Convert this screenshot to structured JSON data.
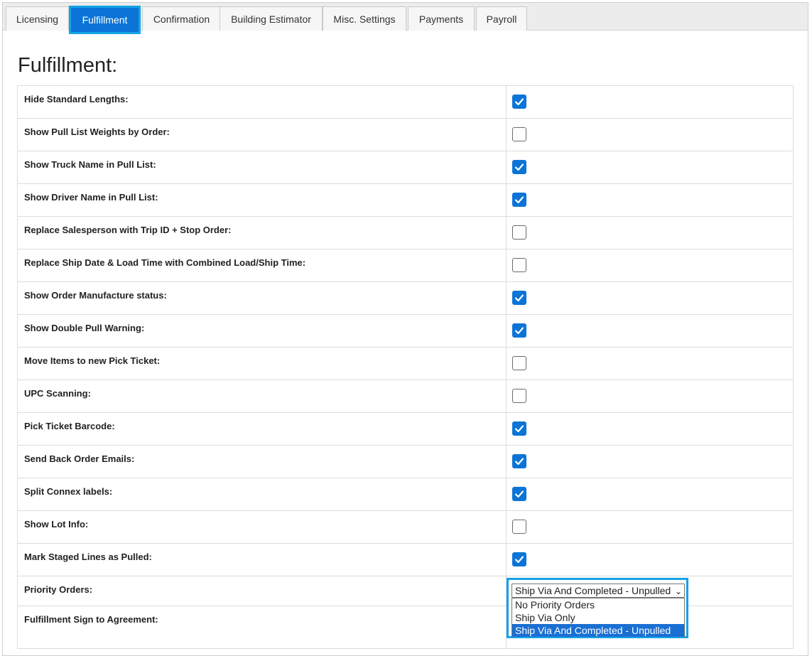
{
  "tabs": [
    {
      "label": "Licensing",
      "active": false
    },
    {
      "label": "Fulfillment",
      "active": true
    },
    {
      "label": "Confirmation",
      "active": false
    },
    {
      "label": "Building Estimator",
      "active": false
    },
    {
      "label": "Misc. Settings",
      "active": false
    },
    {
      "label": "Payments",
      "active": false
    },
    {
      "label": "Payroll",
      "active": false
    }
  ],
  "page_title": "Fulfillment:",
  "settings": [
    {
      "label": "Hide Standard Lengths:",
      "checked": true
    },
    {
      "label": "Show Pull List Weights by Order:",
      "checked": false
    },
    {
      "label": "Show Truck Name in Pull List:",
      "checked": true
    },
    {
      "label": "Show Driver Name in Pull List:",
      "checked": true
    },
    {
      "label": "Replace Salesperson with Trip ID + Stop Order:",
      "checked": false
    },
    {
      "label": "Replace Ship Date & Load Time with Combined Load/Ship Time:",
      "checked": false
    },
    {
      "label": "Show Order Manufacture status:",
      "checked": true
    },
    {
      "label": "Show Double Pull Warning:",
      "checked": true
    },
    {
      "label": "Move Items to new Pick Ticket:",
      "checked": false
    },
    {
      "label": "UPC Scanning:",
      "checked": false
    },
    {
      "label": "Pick Ticket Barcode:",
      "checked": true
    },
    {
      "label": "Send Back Order Emails:",
      "checked": true
    },
    {
      "label": "Split Connex labels:",
      "checked": true
    },
    {
      "label": "Show Lot Info:",
      "checked": false
    },
    {
      "label": "Mark Staged Lines as Pulled:",
      "checked": true
    }
  ],
  "priority_orders": {
    "label": "Priority Orders:",
    "selected": "Ship Via And Completed - Unpulled",
    "options": [
      "No Priority Orders",
      "Ship Via Only",
      "Ship Via And Completed - Unpulled"
    ]
  },
  "sign_agreement": {
    "label": "Fulfillment Sign to Agreement:"
  },
  "colors": {
    "accent": "#0b74d6",
    "highlight_border": "#14a3e6"
  }
}
